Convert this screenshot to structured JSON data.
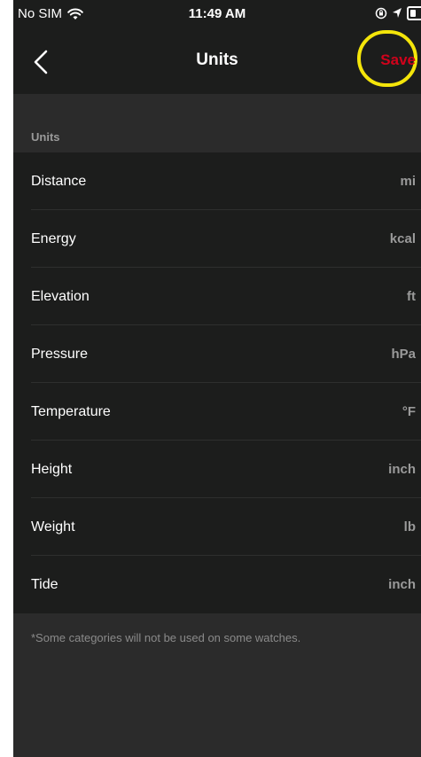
{
  "status_bar": {
    "carrier": "No SIM",
    "time": "11:49 AM",
    "icons": [
      "wifi-icon",
      "orientation-lock-icon",
      "location-icon",
      "battery-icon"
    ]
  },
  "nav": {
    "back_icon": "chevron-left-icon",
    "title": "Units",
    "save_label": "Save"
  },
  "section": {
    "title": "Units"
  },
  "units": [
    {
      "label": "Distance",
      "value": "mi"
    },
    {
      "label": "Energy",
      "value": "kcal"
    },
    {
      "label": "Elevation",
      "value": "ft"
    },
    {
      "label": "Pressure",
      "value": "hPa"
    },
    {
      "label": "Temperature",
      "value": "°F"
    },
    {
      "label": "Height",
      "value": "inch"
    },
    {
      "label": "Weight",
      "value": "lb"
    },
    {
      "label": "Tide",
      "value": "inch"
    }
  ],
  "footer_note": "*Some categories will not be used on some watches.",
  "colors": {
    "accent_save": "#d0021b",
    "highlight": "#f4e50a",
    "background": "#2b2b2b",
    "panel": "#1c1d1c"
  }
}
